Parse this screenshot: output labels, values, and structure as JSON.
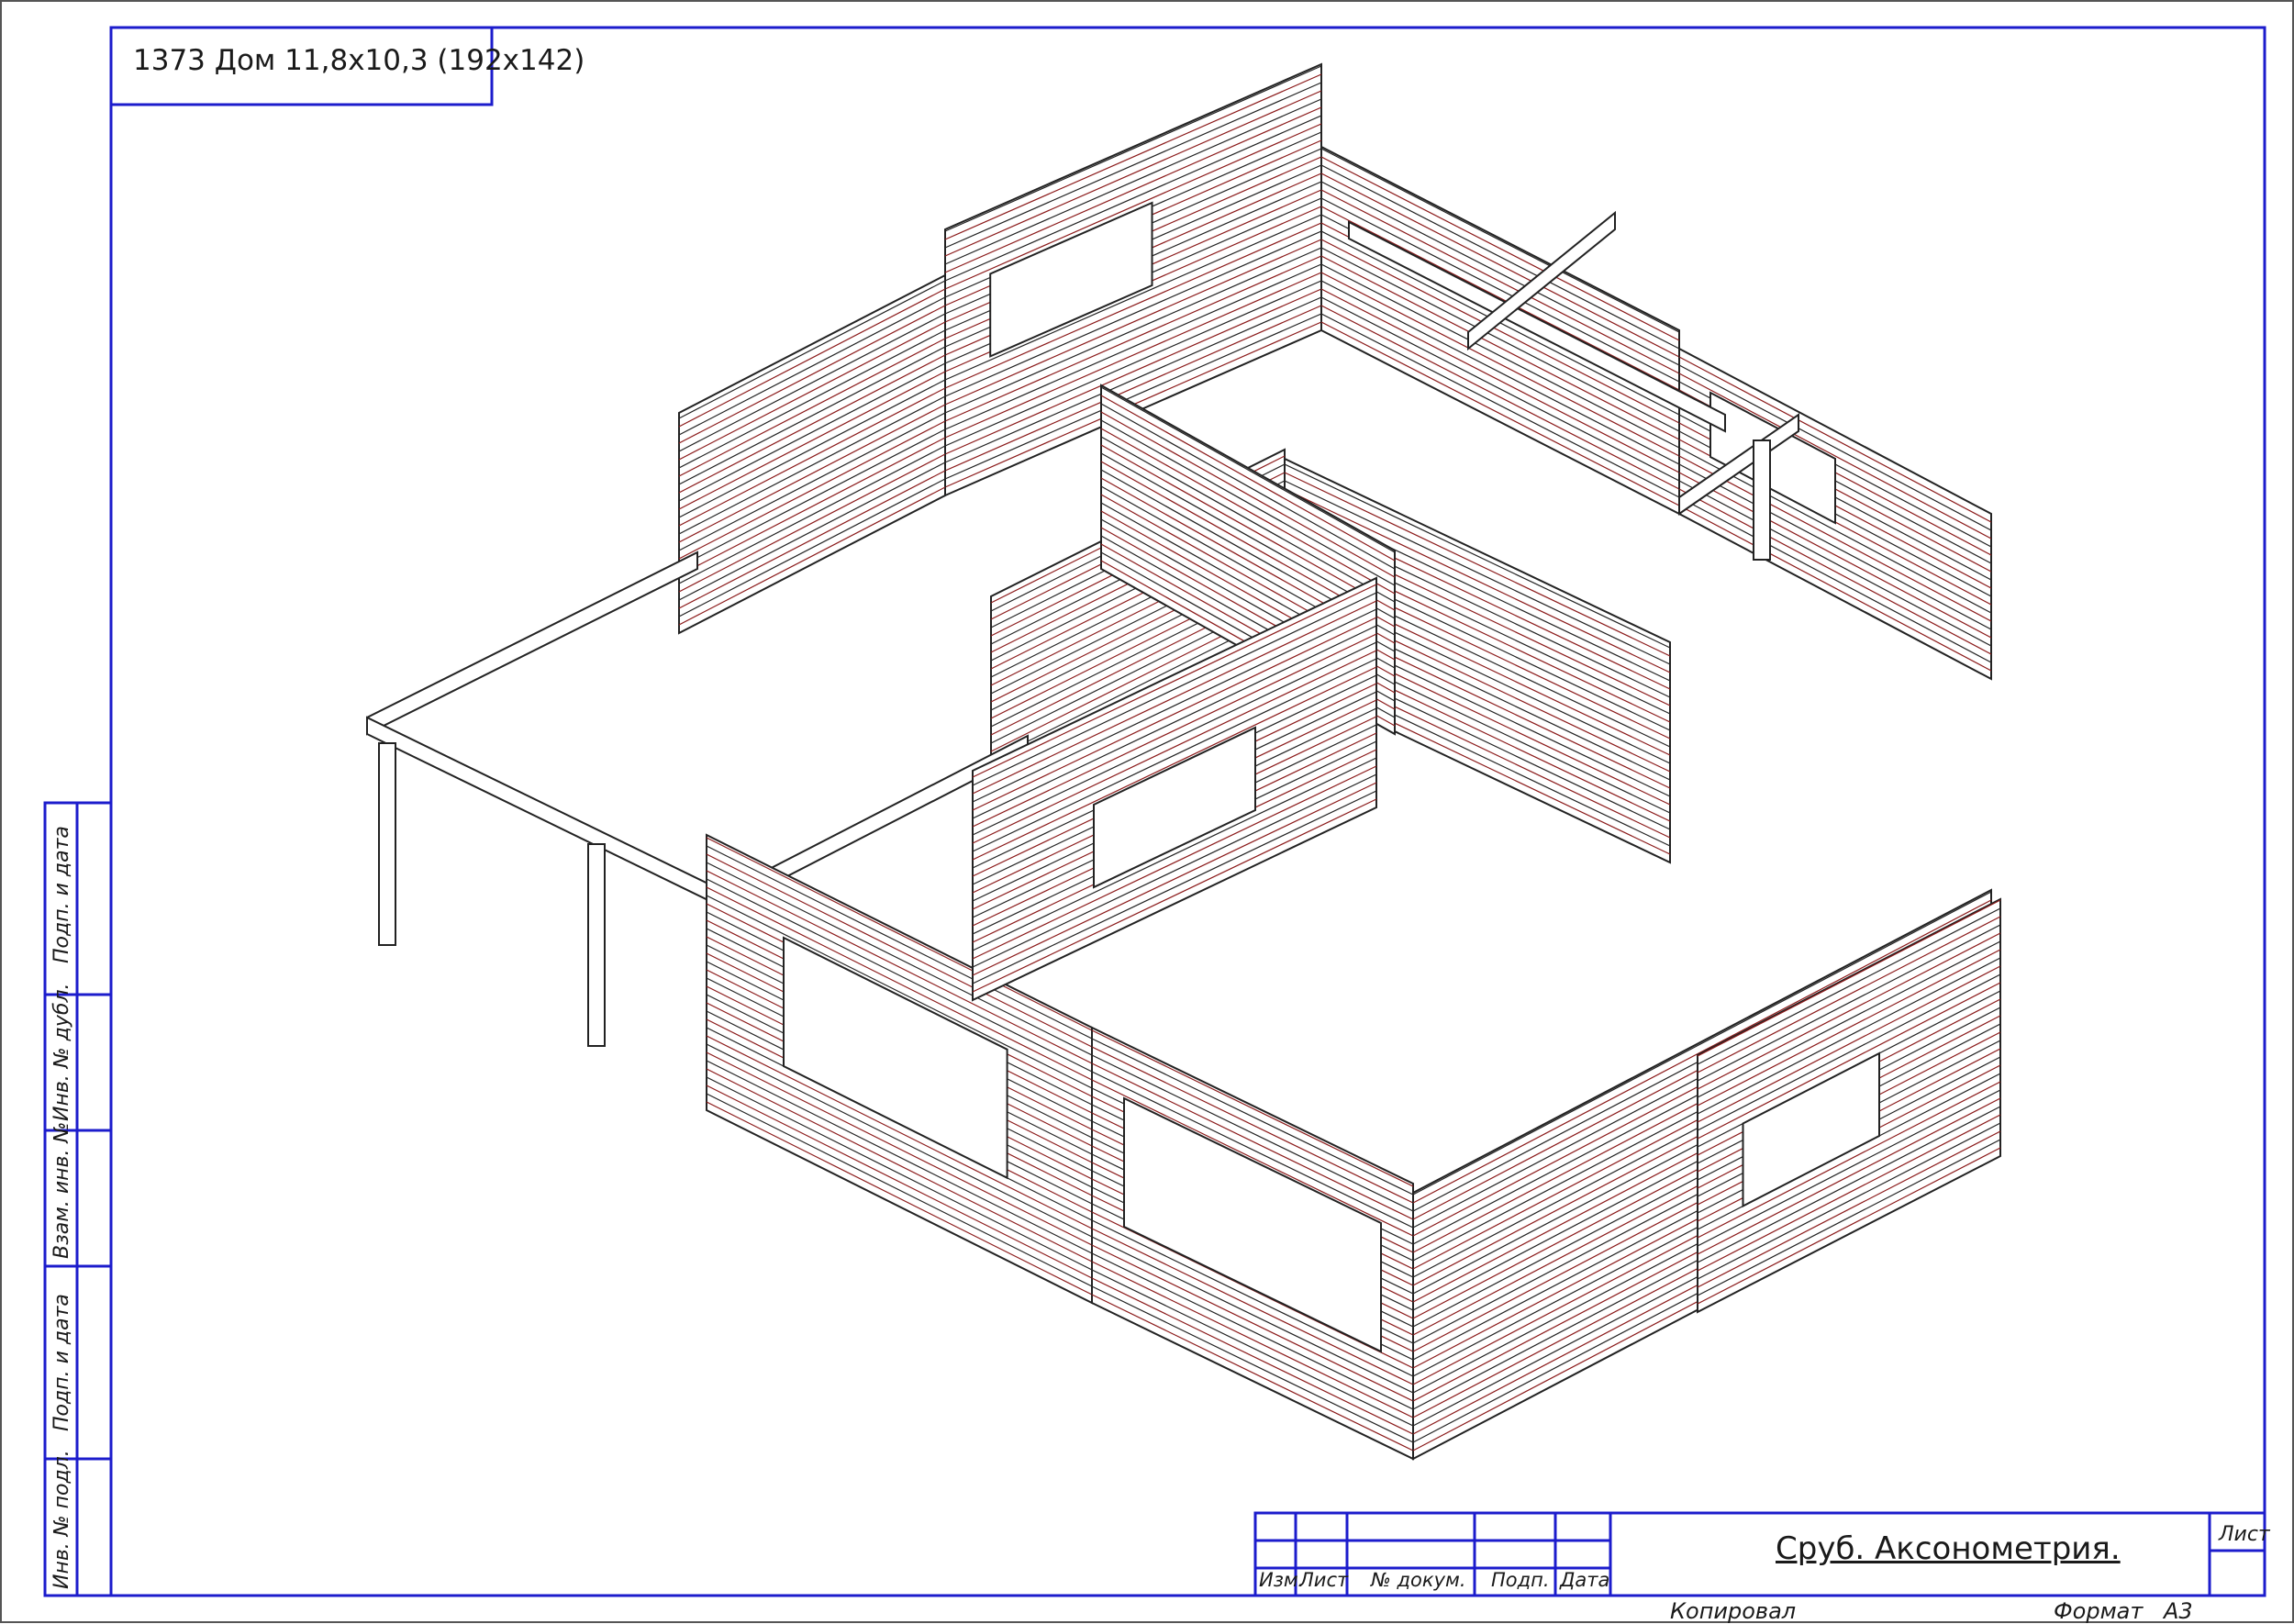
{
  "header": {
    "title": "1373 Дом 11,8x10,3 (192x142)"
  },
  "side_stamp": {
    "labels": [
      "Подп. и дата",
      "Инв. № дубл.",
      "Взам. инв. №",
      "Подп. и дата",
      "Инв. № подл."
    ]
  },
  "title_block": {
    "drawing_title": "Сруб. Аксонометрия.",
    "columns": [
      "Изм.",
      "Лист",
      "№ докум.",
      "Подп.",
      "Дата"
    ],
    "sheet_label": "Лист",
    "copied_label": "Копировал",
    "format_label": "Формат",
    "format_value": "А3"
  },
  "colors": {
    "frame": "#1c1ccc",
    "outline": "#222222",
    "log_line": "#8b1a1a"
  }
}
